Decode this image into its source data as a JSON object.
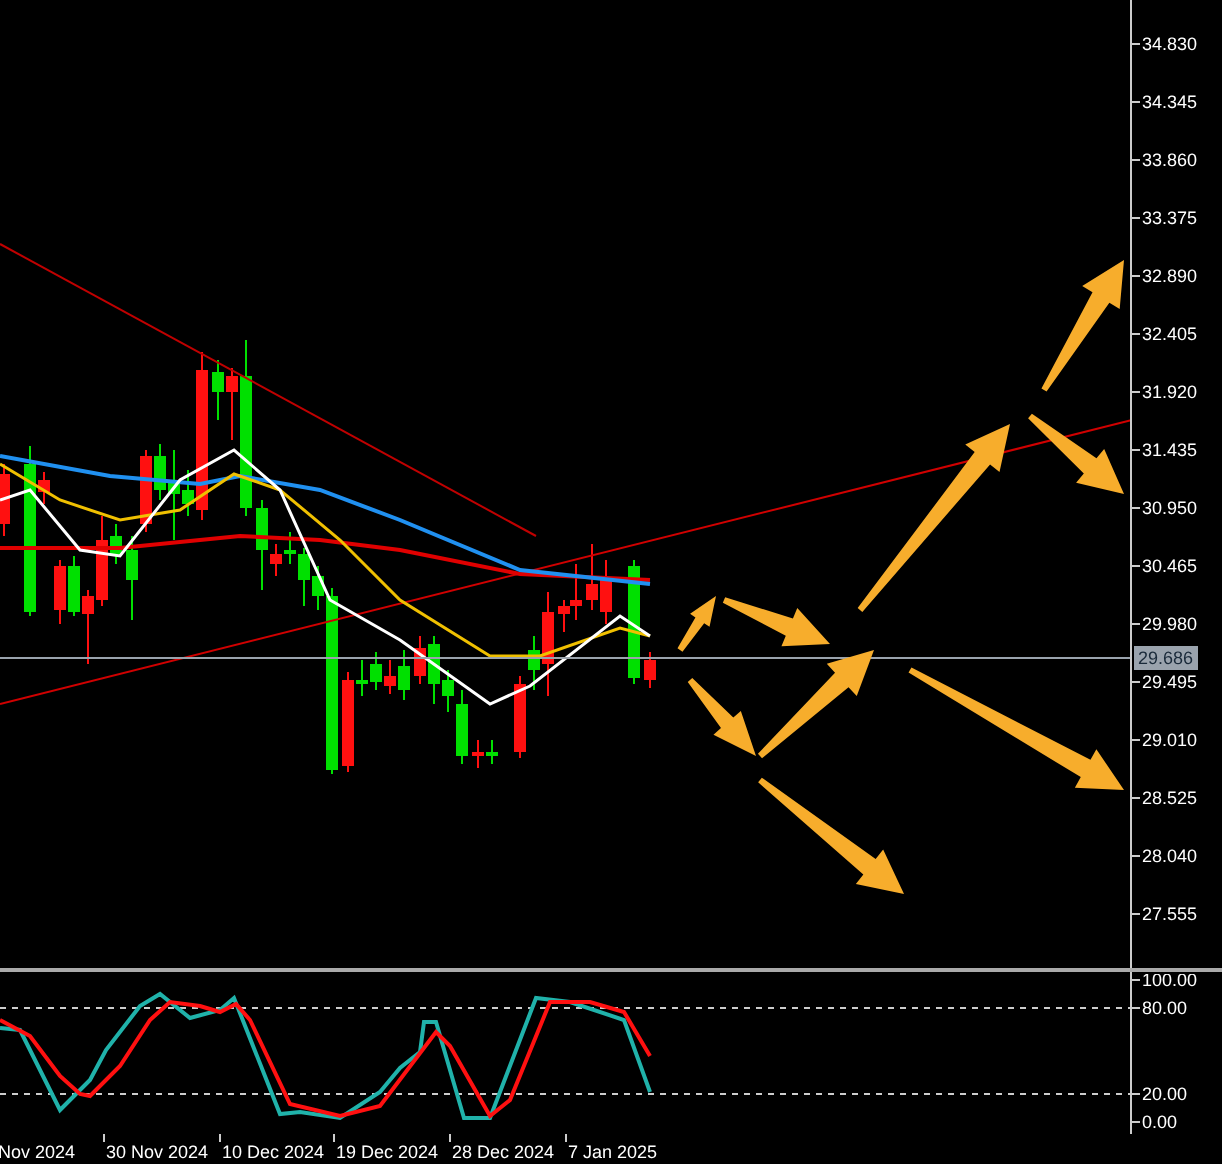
{
  "price_axis": {
    "ticks": [
      "34.830",
      "34.345",
      "33.860",
      "33.375",
      "32.890",
      "32.405",
      "31.920",
      "31.435",
      "30.950",
      "30.465",
      "29.980",
      "29.495",
      "29.010",
      "28.525",
      "28.040",
      "27.555"
    ],
    "current_price": "29.686"
  },
  "oscillator_axis": {
    "ticks": [
      "100.00",
      "80.00",
      "20.00",
      "0.00"
    ]
  },
  "time_axis": {
    "labels": [
      "Nov 2024",
      "30 Nov 2024",
      "10 Dec 2024",
      "19 Dec 2024",
      "28 Dec 2024",
      "7 Jan 2025"
    ]
  }
}
